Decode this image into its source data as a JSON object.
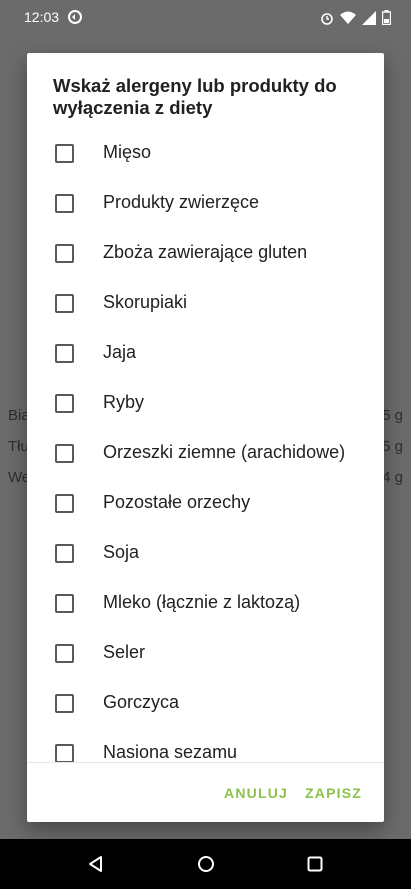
{
  "status_bar": {
    "time": "12:03"
  },
  "background": {
    "rows": [
      {
        "label": "Bia",
        "value": "5 g"
      },
      {
        "label": "Tłu",
        "value": "5 g"
      },
      {
        "label": "We",
        "value": "4 g"
      }
    ]
  },
  "dialog": {
    "title": "Wskaż alergeny lub produkty do wyłączenia z diety",
    "items": [
      {
        "label": "Mięso",
        "checked": false
      },
      {
        "label": "Produkty zwierzęce",
        "checked": false
      },
      {
        "label": "Zboża zawierające gluten",
        "checked": false
      },
      {
        "label": "Skorupiaki",
        "checked": false
      },
      {
        "label": "Jaja",
        "checked": false
      },
      {
        "label": "Ryby",
        "checked": false
      },
      {
        "label": "Orzeszki ziemne (arachidowe)",
        "checked": false
      },
      {
        "label": "Pozostałe orzechy",
        "checked": false
      },
      {
        "label": "Soja",
        "checked": false
      },
      {
        "label": "Mleko (łącznie z laktozą)",
        "checked": false
      },
      {
        "label": "Seler",
        "checked": false
      },
      {
        "label": "Gorczyca",
        "checked": false
      },
      {
        "label": "Nasiona sezamu",
        "checked": false
      }
    ],
    "cancel_label": "ANULUJ",
    "save_label": "ZAPISZ",
    "accent_color": "#8bc34a"
  },
  "nav_bar": {
    "icons": [
      "back-icon",
      "home-icon",
      "recents-icon"
    ]
  }
}
